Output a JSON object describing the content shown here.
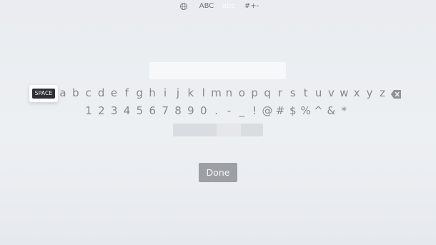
{
  "keyboard": {
    "space_label": "SPACE",
    "letters": [
      "a",
      "b",
      "c",
      "d",
      "e",
      "f",
      "g",
      "h",
      "i",
      "j",
      "k",
      "l",
      "m",
      "n",
      "o",
      "p",
      "q",
      "r",
      "s",
      "t",
      "u",
      "v",
      "w",
      "x",
      "y",
      "z"
    ],
    "symbols": [
      "1",
      "2",
      "3",
      "4",
      "5",
      "6",
      "7",
      "8",
      "9",
      "0",
      ".",
      "-",
      "_",
      "!",
      "@",
      "#",
      "$",
      "%",
      "^",
      "&",
      "*"
    ],
    "delete_icon": "backspace-icon"
  },
  "modes": {
    "globe_icon": "globe-icon",
    "items": [
      "ABC",
      "abc",
      "#+-"
    ],
    "selected": "abc"
  },
  "done_label": "Done",
  "colors": {
    "background": "#eceff2",
    "key_text": "#85888d",
    "done_bg": "#9c9fa4"
  }
}
